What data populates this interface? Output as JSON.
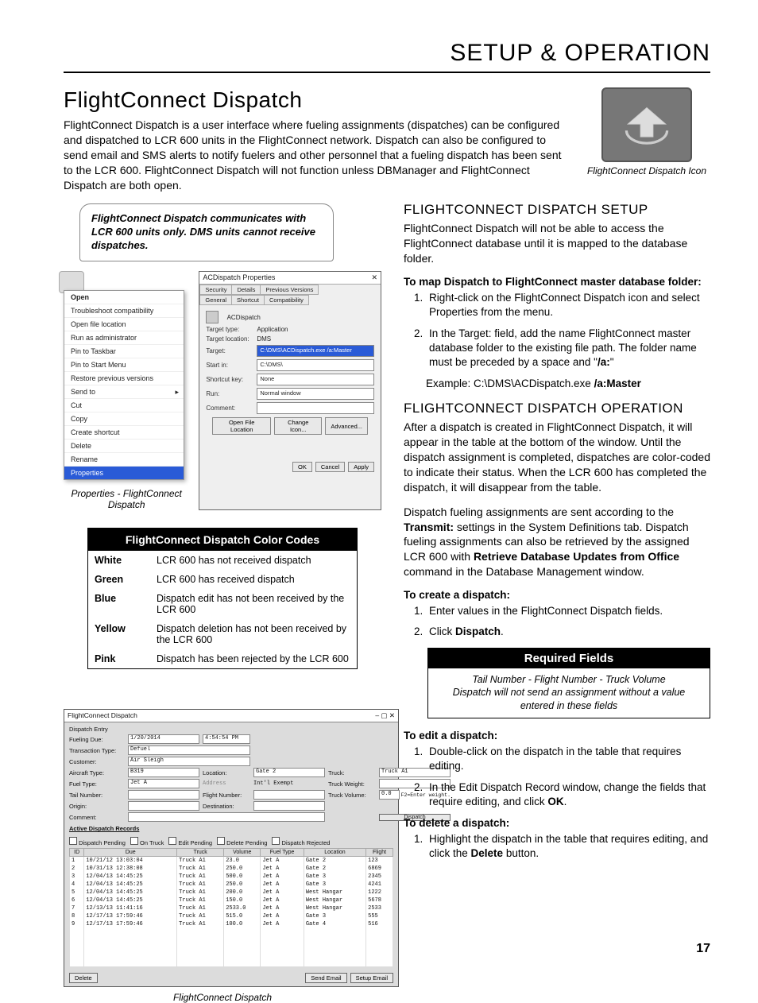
{
  "header": {
    "section": "SETUP & OPERATION"
  },
  "title": "FlightConnect Dispatch",
  "intro": "FlightConnect Dispatch is a user interface where fueling assignments (dispatches) can be configured and dispatched to LCR 600 units in the FlightConnect network. Dispatch can also be configured to send email and SMS alerts to notify fuelers and other personnel that a fueling dispatch has been sent to the LCR 600. FlightConnect Dispatch will not function unless DBManager and FlightConnect Dispatch are both open.",
  "icon_caption": "FlightConnect Dispatch Icon",
  "callout": "FlightConnect Dispatch communicates with LCR 600 units only. DMS units cannot receive dispatches.",
  "context_menu": {
    "items": [
      "Open",
      "Troubleshoot compatibility",
      "Open file location",
      "Run as administrator",
      "Pin to Taskbar",
      "Pin to Start Menu",
      "Restore previous versions",
      "Send to",
      "Cut",
      "Copy",
      "Create shortcut",
      "Delete",
      "Rename",
      "Properties"
    ],
    "selected": "Properties",
    "arrow_item": "Send to",
    "caption": "Properties - FlightConnect Dispatch"
  },
  "properties_dialog": {
    "title": "ACDispatch Properties",
    "tabs_row1": [
      "Security",
      "Details",
      "Previous Versions"
    ],
    "tabs_row2": [
      "General",
      "Shortcut",
      "Compatibility"
    ],
    "app_label": "ACDispatch",
    "rows": {
      "target_type_lbl": "Target type:",
      "target_type": "Application",
      "target_loc_lbl": "Target location:",
      "target_loc": "DMS",
      "target_lbl": "Target:",
      "target": "C:\\DMS\\ACDispatch.exe /a:Master",
      "startin_lbl": "Start in:",
      "startin": "C:\\DMS\\",
      "shortcut_lbl": "Shortcut key:",
      "shortcut": "None",
      "run_lbl": "Run:",
      "run": "Normal window",
      "comment_lbl": "Comment:",
      "comment": ""
    },
    "btns1": [
      "Open File Location",
      "Change Icon...",
      "Advanced..."
    ],
    "btns2": [
      "OK",
      "Cancel",
      "Apply"
    ]
  },
  "color_codes": {
    "title": "FlightConnect Dispatch Color Codes",
    "rows": [
      {
        "c": "White",
        "d": "LCR 600 has not received dispatch"
      },
      {
        "c": "Green",
        "d": "LCR 600 has received dispatch"
      },
      {
        "c": "Blue",
        "d": "Dispatch edit has not been received by the LCR 600"
      },
      {
        "c": "Yellow",
        "d": "Dispatch deletion has not been received by the LCR 600"
      },
      {
        "c": "Pink",
        "d": "Dispatch has been rejected by the LCR 600"
      }
    ]
  },
  "setup": {
    "heading": "FLIGHTCONNECT DISPATCH SETUP",
    "para": "FlightConnect Dispatch will not be able to access the FlightConnect database until it is mapped to the database folder.",
    "step_title": "To map Dispatch to FlightConnect master database folder:",
    "steps": [
      "Right-click on the FlightConnect Dispatch icon and select Properties from the menu.",
      "In the Target: field, add the name FlightConnect master database folder to the existing file path. The folder name must be preceded by a space and \"/a:\""
    ],
    "example_label": "Example:  C:\\DMS\\ACDispatch.exe ",
    "example_bold": "/a:Master"
  },
  "operation": {
    "heading": "FLIGHTCONNECT DISPATCH OPERATION",
    "para1": "After a dispatch is created in FlightConnect Dispatch, it will appear in the table at the bottom of the window. Until the dispatch assignment is completed, dispatches are color-coded to indicate their status. When the LCR 600 has completed the dispatch, it will disappear from the table.",
    "para2_a": "Dispatch fueling assignments are sent according to the ",
    "para2_b": "Transmit:",
    "para2_c": " settings in the System Definitions tab. Dispatch fueling assignments can also be retrieved by the assigned LCR 600 with ",
    "para2_d": "Retrieve Database Updates from Office",
    "para2_e": " command in the Database Management window.",
    "create_title": "To create a dispatch:",
    "create_steps": [
      "Enter values in the FlightConnect Dispatch fields.",
      "Click Dispatch."
    ],
    "required": {
      "hdr": "Required Fields",
      "line1": "Tail Number - Flight Number - Truck Volume",
      "line2": "Dispatch will not send an assignment without a value entered in these fields"
    },
    "edit_title": "To edit a dispatch:",
    "edit_steps": [
      "Double-click on the dispatch in the table that requires editing.",
      "In the Edit Dispatch Record window, change the fields that require editing, and click OK."
    ],
    "delete_title": "To delete a dispatch:",
    "delete_steps": [
      "Highlight the dispatch in the table that requires editing, and click the Delete button."
    ]
  },
  "dispatch_window": {
    "title": "FlightConnect Dispatch",
    "entry_label": "Dispatch Entry",
    "fields": {
      "fueling_due_lbl": "Fueling Due:",
      "fueling_due_date": "1/20/2014",
      "fueling_due_time": "4:54:54 PM",
      "trans_type_lbl": "Transaction Type:",
      "trans_type": "Defuel",
      "customer_lbl": "Customer:",
      "customer": "Air Sleigh",
      "aircraft_type_lbl": "Aircraft Type:",
      "aircraft_type": "B319",
      "location_lbl": "Location:",
      "location": "Gate 2",
      "truck_lbl": "Truck:",
      "truck": "Truck A1",
      "fuel_type_lbl": "Fuel Type:",
      "fuel_type": "Jet A",
      "address_lbl": "Address",
      "intl_lbl": "Int'l Exempt",
      "truck_weight_lbl": "Truck Weight:",
      "tail_lbl": "Tail Number:",
      "flight_lbl": "Flight Number:",
      "truck_vol_lbl": "Truck Volume:",
      "truck_vol": "0.0",
      "f2": "F2=Enter weight.",
      "origin_lbl": "Origin:",
      "dest_lbl": "Destination:",
      "comment_lbl": "Comment:",
      "dispatch_btn": "Dispatch"
    },
    "active_label": "Active Dispatch Records",
    "checks": [
      "Dispatch Pending",
      "On Truck",
      "Edit Pending",
      "Delete Pending",
      "Dispatch Rejected"
    ],
    "columns": [
      "ID",
      "Due",
      "Truck",
      "Volume",
      "Fuel Type",
      "Location",
      "Flight"
    ],
    "rows": [
      [
        "1",
        "10/21/12 13:03:04",
        "Truck A1",
        "23.0",
        "Jet A",
        "Gate 2",
        "123"
      ],
      [
        "2",
        "10/31/13 12:38:08",
        "Truck A1",
        "250.0",
        "Jet A",
        "Gate 2",
        "6869"
      ],
      [
        "3",
        "12/04/13 14:45:25",
        "Truck A1",
        "500.0",
        "Jet A",
        "Gate 3",
        "2345"
      ],
      [
        "4",
        "12/04/13 14:45:25",
        "Truck A1",
        "250.0",
        "Jet A",
        "Gate 3",
        "4241"
      ],
      [
        "5",
        "12/04/13 14:45:25",
        "Truck A1",
        "200.0",
        "Jet A",
        "West Hangar",
        "1222"
      ],
      [
        "6",
        "12/04/13 14:45:25",
        "Truck A1",
        "150.0",
        "Jet A",
        "West Hangar",
        "5678"
      ],
      [
        "7",
        "12/13/13 11:41:16",
        "Truck A1",
        "2533.0",
        "Jet A",
        "West Hangar",
        "2533"
      ],
      [
        "8",
        "12/17/13 17:59:46",
        "Truck A1",
        "515.0",
        "Jet A",
        "Gate 3",
        "555"
      ],
      [
        "9",
        "12/17/13 17:59:46",
        "Truck A1",
        "100.0",
        "Jet A",
        "Gate 4",
        "516"
      ]
    ],
    "bottom_left": "Delete",
    "bottom_right": [
      "Send Email",
      "Setup Email"
    ],
    "caption": "FlightConnect Dispatch"
  },
  "page_number": "17"
}
